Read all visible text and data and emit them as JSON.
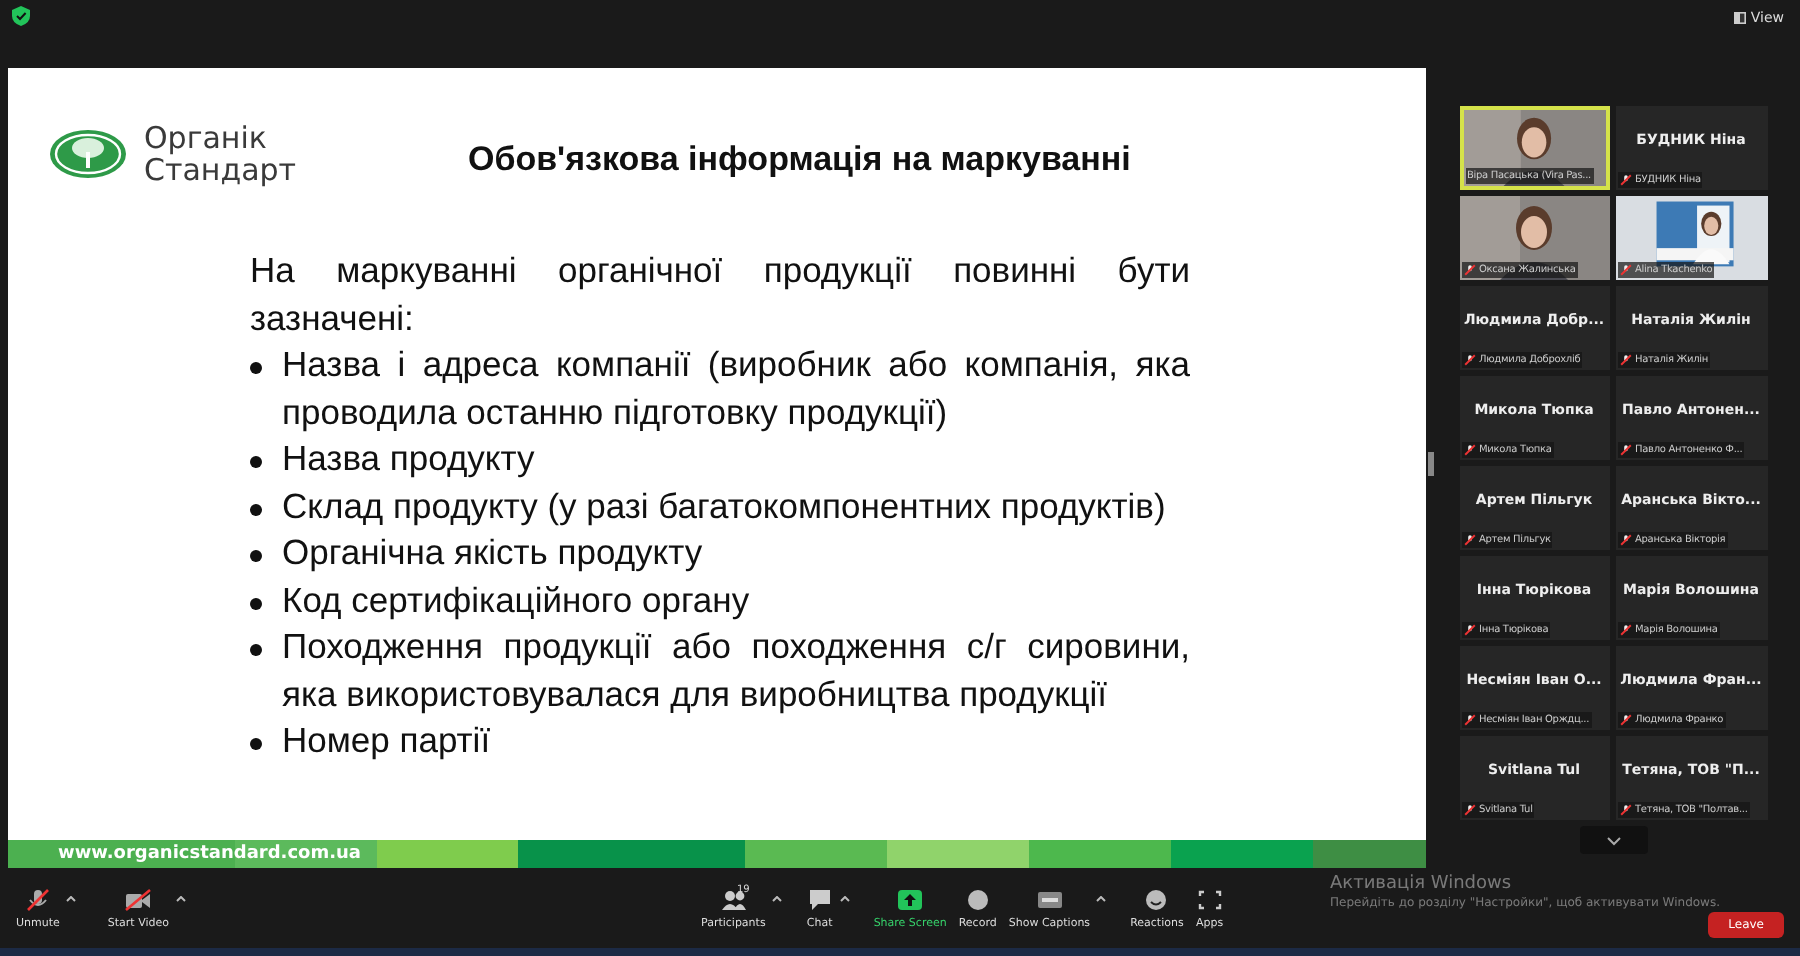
{
  "top_bar": {
    "view_button": "View"
  },
  "slide": {
    "logo_text": [
      "Органік",
      "Стандарт"
    ],
    "title": "Обов'язкова інформація на маркуванні",
    "intro": "На маркуванні органічної продукції повинні бути зазначені:",
    "bullets": [
      "Назва і адреса компанії (виробник або компанія, яка проводила останню підготовку продукції)",
      "Назва продукту",
      "Склад продукту (у разі багатокомпонентних продуктів)",
      "Органічна якість продукту",
      "Код сертифікаційного органу",
      "Походження продукції або походження с/г сировини, яка використовувалася для виробництва продукції",
      "Номер партії"
    ],
    "footer_url": "www.organicstandard.com.ua"
  },
  "participants": [
    {
      "kind": "video",
      "label": "Віра Пасацька (Vira Pas...",
      "speaking": true,
      "muted": false
    },
    {
      "kind": "name",
      "name": "БУДНИК Ніна",
      "label": "БУДНИК Ніна",
      "speaking": false,
      "muted": true
    },
    {
      "kind": "video",
      "label": "Оксана Жалинська",
      "speaking": false,
      "muted": true
    },
    {
      "kind": "video",
      "label": "Alina Tkachenko",
      "speaking": false,
      "muted": true
    },
    {
      "kind": "name",
      "name": "Людмила  Добр...",
      "label": "Людмила Доброхліб",
      "speaking": false,
      "muted": true
    },
    {
      "kind": "name",
      "name": "Наталія Жилін",
      "label": "Наталія Жилін",
      "speaking": false,
      "muted": true
    },
    {
      "kind": "name",
      "name": "Микола Тюпка",
      "label": "Микола Тюпка",
      "speaking": false,
      "muted": true
    },
    {
      "kind": "name",
      "name": "Павло  Антонен...",
      "label": "Павло Антоненко  Ф...",
      "speaking": false,
      "muted": true
    },
    {
      "kind": "name",
      "name": "Артем Пільгук",
      "label": "Артем Пільгук",
      "speaking": false,
      "muted": true
    },
    {
      "kind": "name",
      "name": "Аранська  Вікто...",
      "label": "Аранська Вікторія",
      "speaking": false,
      "muted": true
    },
    {
      "kind": "name",
      "name": "Інна Тюрікова",
      "label": "Інна Тюрікова",
      "speaking": false,
      "muted": true
    },
    {
      "kind": "name",
      "name": "Марія Волошина",
      "label": "Марія Волошина",
      "speaking": false,
      "muted": true
    },
    {
      "kind": "name",
      "name": "Несміян Іван О...",
      "label": "Несміян Іван Орждц...",
      "speaking": false,
      "muted": true
    },
    {
      "kind": "name",
      "name": "Людмила  Фран...",
      "label": "Людмила Франко",
      "speaking": false,
      "muted": true
    },
    {
      "kind": "name",
      "name": "Svitlana Tul",
      "label": "Svitlana Tul",
      "speaking": false,
      "muted": true
    },
    {
      "kind": "name",
      "name": "Тетяна, ТОВ  \"П...",
      "label": "Тетяна, ТОВ \"Полтав...",
      "speaking": false,
      "muted": true
    }
  ],
  "toolbar": {
    "left": [
      {
        "kind": "mic",
        "label": "Unmute",
        "off": true,
        "caret": true
      },
      {
        "kind": "video",
        "label": "Start Video",
        "off": true,
        "caret": true
      }
    ],
    "center": [
      {
        "kind": "participants",
        "label": "Participants",
        "count": "19",
        "caret": true
      },
      {
        "kind": "chat",
        "label": "Chat",
        "caret": true
      },
      {
        "kind": "share",
        "label": "Share Screen"
      },
      {
        "kind": "record",
        "label": "Record"
      },
      {
        "kind": "captions",
        "label": "Show Captions",
        "caret": true
      },
      {
        "kind": "reactions",
        "label": "Reactions"
      },
      {
        "kind": "apps",
        "label": "Apps"
      }
    ],
    "leave": "Leave"
  },
  "activation": {
    "title": "Активація Windows",
    "text": "Перейдіть до розділу \"Настройки\", щоб активувати Windows."
  }
}
